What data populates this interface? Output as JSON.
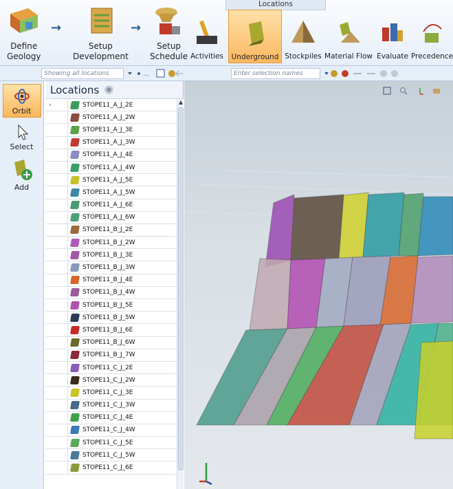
{
  "ribbon": {
    "workflow": [
      {
        "label_line1": "Define",
        "label_line2": "Geology",
        "icon": "define-geology-icon"
      },
      {
        "label_line1": "Setup",
        "label_line2": "Development",
        "icon": "setup-development-icon"
      },
      {
        "label_line1": "Setup",
        "label_line2": "Schedule",
        "icon": "setup-schedule-icon"
      }
    ],
    "group_title": "Locations",
    "tools": [
      {
        "label": "Activities",
        "icon": "activities-icon"
      },
      {
        "label": "Underground",
        "icon": "underground-icon",
        "active": true
      },
      {
        "label": "Stockpiles",
        "icon": "stockpiles-icon"
      },
      {
        "label": "Material Flow",
        "icon": "material-flow-icon"
      },
      {
        "label": "Evaluate",
        "icon": "evaluate-icon"
      },
      {
        "label": "Precedence",
        "icon": "precedence-icon"
      }
    ]
  },
  "locations_toolbar": {
    "filter_placeholder": "Showing all locations"
  },
  "viewport_toolbar": {
    "filter_placeholder": "Enter selection names"
  },
  "left_tools": [
    {
      "label": "Orbit",
      "icon": "orbit-icon",
      "active": true
    },
    {
      "label": "Select",
      "icon": "cursor-icon"
    },
    {
      "label": "Add",
      "icon": "add-location-icon"
    }
  ],
  "panel": {
    "title": "Locations",
    "items": [
      {
        "name": "STOPE11_A_J_2E",
        "color": "#3a9e5a"
      },
      {
        "name": "STOPE11_A_J_2W",
        "color": "#8a4e3c"
      },
      {
        "name": "STOPE11_A_J_3E",
        "color": "#5aa048"
      },
      {
        "name": "STOPE11_A_J_3W",
        "color": "#c23a32"
      },
      {
        "name": "STOPE11_A_J_4E",
        "color": "#8c8cc4"
      },
      {
        "name": "STOPE11_A_J_4W",
        "color": "#3aa06a"
      },
      {
        "name": "STOPE11_A_J_5E",
        "color": "#c8c02a"
      },
      {
        "name": "STOPE11_A_J_5W",
        "color": "#3c8aa8"
      },
      {
        "name": "STOPE11_A_J_6E",
        "color": "#4a9c6c"
      },
      {
        "name": "STOPE11_A_J_6W",
        "color": "#4aa07a"
      },
      {
        "name": "STOPE11_B_J_2E",
        "color": "#9a6a3a"
      },
      {
        "name": "STOPE11_B_J_2W",
        "color": "#b05ab8"
      },
      {
        "name": "STOPE11_B_J_3E",
        "color": "#a05aa8"
      },
      {
        "name": "STOPE11_B_J_3W",
        "color": "#8a9ab8"
      },
      {
        "name": "STOPE11_B_J_4E",
        "color": "#d8652a"
      },
      {
        "name": "STOPE11_B_J_4W",
        "color": "#9c5a9c"
      },
      {
        "name": "STOPE11_B_J_5E",
        "color": "#b056b0"
      },
      {
        "name": "STOPE11_B_J_5W",
        "color": "#2c3a5c"
      },
      {
        "name": "STOPE11_B_J_6E",
        "color": "#c82a2a"
      },
      {
        "name": "STOPE11_B_J_6W",
        "color": "#6a6a2c"
      },
      {
        "name": "STOPE11_B_J_7W",
        "color": "#8c2a3a"
      },
      {
        "name": "STOPE11_C_J_2E",
        "color": "#8a5ab8"
      },
      {
        "name": "STOPE11_C_J_2W",
        "color": "#3a2a1a"
      },
      {
        "name": "STOPE11_C_J_3E",
        "color": "#c8c42a"
      },
      {
        "name": "STOPE11_C_J_3W",
        "color": "#4a6a8c"
      },
      {
        "name": "STOPE11_C_J_4E",
        "color": "#3aa04a"
      },
      {
        "name": "STOPE11_C_J_4W",
        "color": "#3a7ab8"
      },
      {
        "name": "STOPE11_C_J_5E",
        "color": "#5aaa5a"
      },
      {
        "name": "STOPE11_C_J_5W",
        "color": "#4a7a9c"
      },
      {
        "name": "STOPE11_C_J_6E",
        "color": "#8a9a3a"
      }
    ]
  },
  "viewport": {
    "controls": [
      "zoom-extents-icon",
      "zoom-icon",
      "axes-icon",
      "camera-view-icon"
    ],
    "stope_colors": [
      "#9a4ab0",
      "#5a4a3a",
      "#d0d02a",
      "#2a9aa0",
      "#4aa06a",
      "#2a8ab8",
      "#c0a8b0",
      "#b04ab0",
      "#a0a8c0",
      "#9a9ab8",
      "#d8652a",
      "#b08ab8",
      "#4a9a8a",
      "#a8a0a8",
      "#4aaa5a",
      "#c04a3a",
      "#a0a0b8",
      "#2ab0a0",
      "#4ab08a",
      "#c8d02a"
    ]
  }
}
